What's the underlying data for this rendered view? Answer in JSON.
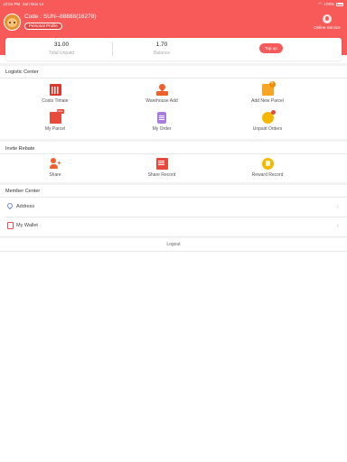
{
  "status_bar": {
    "time": "12:04 PM",
    "date": "Sun Nov 14",
    "battery": "100%"
  },
  "header": {
    "code": "Code : SUN--88888(16278)",
    "profile_button": "Personal Profile",
    "service_label": "Online Service"
  },
  "account": {
    "total_unpaid_value": "31.00",
    "total_unpaid_label": "Total Unpaid",
    "balance_value": "1.70",
    "balance_label": "Balance",
    "topup_label": "Top up"
  },
  "logistic": {
    "title": "Logistic Center",
    "items": [
      {
        "label": "Costs Timate",
        "icon": "calculator-icon"
      },
      {
        "label": "Warehouse Add",
        "icon": "location-icon"
      },
      {
        "label": "Add New Parcel",
        "icon": "add-parcel-icon"
      },
      {
        "label": "My Parcel",
        "icon": "parcel-icon",
        "badge": "New"
      },
      {
        "label": "My Order",
        "icon": "order-icon"
      },
      {
        "label": "Unpaid Orders",
        "icon": "unpaid-icon"
      }
    ]
  },
  "rebate": {
    "title": "Invite Rebate",
    "items": [
      {
        "label": "Share",
        "icon": "add-user-icon"
      },
      {
        "label": "Share Record",
        "icon": "record-icon"
      },
      {
        "label": "Reward Record",
        "icon": "reward-icon"
      }
    ]
  },
  "member": {
    "title": "Member Center",
    "items": [
      {
        "label": "Address",
        "icon": "address-icon"
      },
      {
        "label": "My Wallet",
        "icon": "wallet-icon"
      }
    ]
  },
  "logout_label": "Logout",
  "colors": {
    "brand": "#f75a59",
    "background": "#ffffff",
    "separator": "#f3f3f3"
  }
}
